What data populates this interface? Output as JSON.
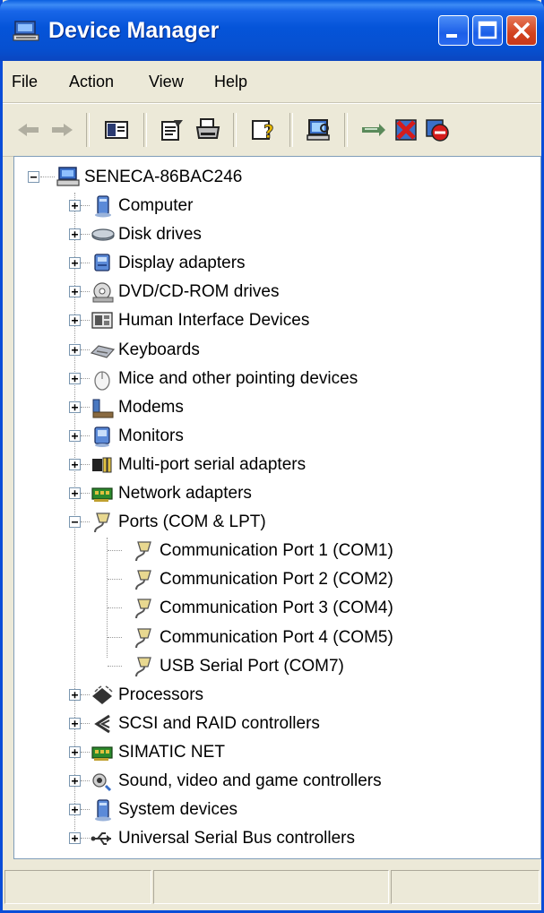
{
  "window": {
    "title": "Device Manager"
  },
  "menu": [
    "File",
    "Action",
    "View",
    "Help"
  ],
  "toolbar": {
    "icons": [
      "back-arrow-icon",
      "forward-arrow-icon",
      "show-hide-console-tree-icon",
      "properties-icon",
      "print-icon",
      "help-icon",
      "scan-hardware-icon",
      "update-driver-icon",
      "uninstall-icon",
      "disable-device-icon"
    ]
  },
  "tree": {
    "root": "SENECA-86BAC246",
    "categories": [
      {
        "label": "Computer",
        "icon": "computer-icon",
        "expanded": false
      },
      {
        "label": "Disk drives",
        "icon": "disk-drive-icon",
        "expanded": false
      },
      {
        "label": "Display adapters",
        "icon": "display-adapter-icon",
        "expanded": false
      },
      {
        "label": "DVD/CD-ROM drives",
        "icon": "dvd-drive-icon",
        "expanded": false
      },
      {
        "label": "Human Interface Devices",
        "icon": "hid-icon",
        "expanded": false
      },
      {
        "label": "Keyboards",
        "icon": "keyboard-icon",
        "expanded": false
      },
      {
        "label": "Mice and other pointing devices",
        "icon": "mouse-icon",
        "expanded": false
      },
      {
        "label": "Modems",
        "icon": "modem-icon",
        "expanded": false
      },
      {
        "label": "Monitors",
        "icon": "monitor-icon",
        "expanded": false
      },
      {
        "label": "Multi-port serial adapters",
        "icon": "serial-adapter-icon",
        "expanded": false
      },
      {
        "label": "Network adapters",
        "icon": "network-adapter-icon",
        "expanded": false
      },
      {
        "label": "Ports (COM & LPT)",
        "icon": "port-icon",
        "expanded": true,
        "children": [
          "Communication Port 1 (COM1)",
          "Communication Port 2 (COM2)",
          "Communication Port 3 (COM4)",
          "Communication Port 4 (COM5)",
          "USB Serial Port (COM7)"
        ]
      },
      {
        "label": "Processors",
        "icon": "processor-icon",
        "expanded": false
      },
      {
        "label": "SCSI and RAID controllers",
        "icon": "scsi-icon",
        "expanded": false
      },
      {
        "label": "SIMATIC NET",
        "icon": "network-adapter-icon",
        "expanded": false
      },
      {
        "label": "Sound, video and game controllers",
        "icon": "sound-icon",
        "expanded": false
      },
      {
        "label": "System devices",
        "icon": "system-device-icon",
        "expanded": false
      },
      {
        "label": "Universal Serial Bus controllers",
        "icon": "usb-icon",
        "expanded": false
      }
    ]
  },
  "colors": {
    "titlebar": "#0554d9",
    "chrome": "#ece9d8",
    "close": "#d2421e"
  }
}
